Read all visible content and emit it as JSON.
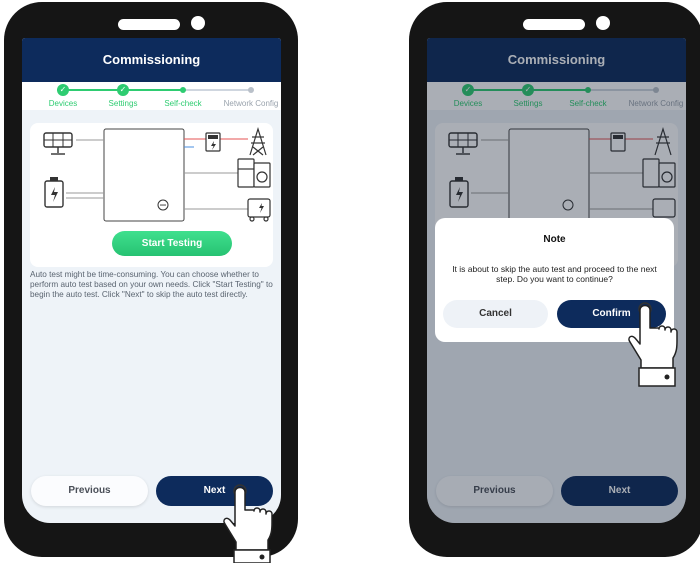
{
  "left_screen": {
    "title": "Commissioning",
    "steps": [
      {
        "label": "Devices",
        "state": "done"
      },
      {
        "label": "Settings",
        "state": "done"
      },
      {
        "label": "Self-check",
        "state": "current"
      },
      {
        "label": "Network Config",
        "state": "pending"
      }
    ],
    "start_testing_label": "Start Testing",
    "description": "Auto test might be time-consuming. You can choose whether to perform auto test based on your own needs. Click \"Start Testing\" to begin the auto test. Click \"Next\" to skip the auto test directly.",
    "previous_label": "Previous",
    "next_label": "Next"
  },
  "right_screen": {
    "title": "Commissioning",
    "steps": [
      {
        "label": "Devices",
        "state": "done"
      },
      {
        "label": "Settings",
        "state": "done"
      },
      {
        "label": "Self-check",
        "state": "current"
      },
      {
        "label": "Network Config",
        "state": "pending"
      }
    ],
    "dialog": {
      "title": "Note",
      "message": "It is about to skip the auto test and proceed to the next step. Do you want to continue?",
      "cancel_label": "Cancel",
      "confirm_label": "Confirm"
    },
    "previous_label": "Previous",
    "next_label": "Next"
  },
  "colors": {
    "primary": "#0d2b5c",
    "success": "#2ecc71",
    "screen_bg": "#eef3f8"
  },
  "icons": [
    "solar-panel-icon",
    "battery-icon",
    "meter-icon",
    "power-tower-icon",
    "appliances-icon",
    "generator-icon",
    "pointing-hand-icon"
  ]
}
